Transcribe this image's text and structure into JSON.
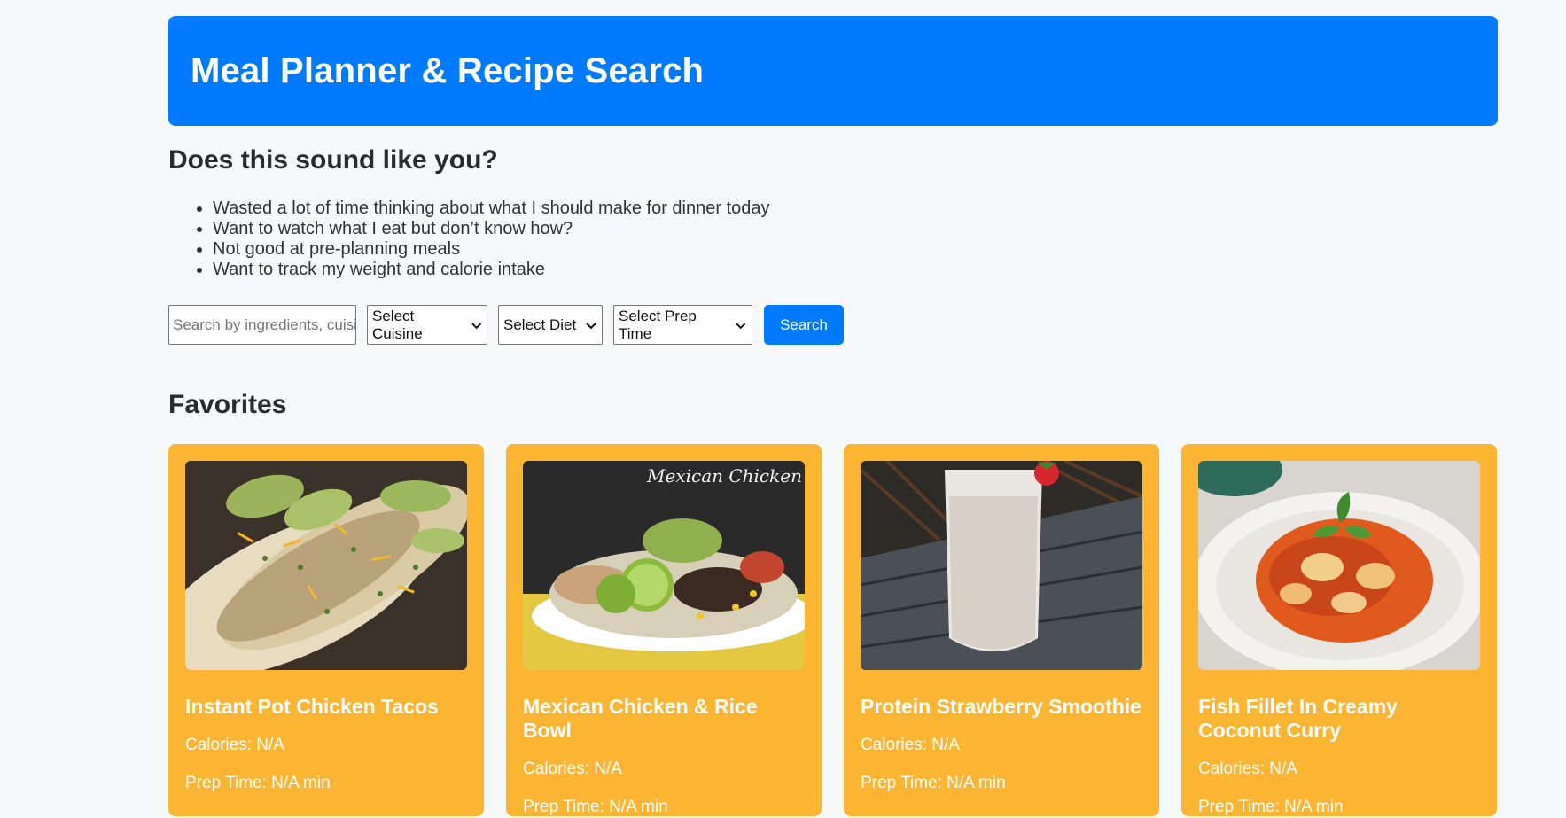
{
  "header": {
    "title": "Meal Planner & Recipe Search"
  },
  "intro": {
    "heading": "Does this sound like you?",
    "items": [
      "Wasted a lot of time thinking about what I should make for dinner today",
      "Want to watch what I eat but don’t know how?",
      "Not good at pre-planning meals",
      "Want to track my weight and calorie intake"
    ]
  },
  "search": {
    "placeholder": "Search by ingredients, cuisine, or dish",
    "cuisine": "Select Cuisine",
    "diet": "Select Diet",
    "prep_time": "Select Prep Time",
    "button": "Search"
  },
  "favorites": {
    "heading": "Favorites",
    "cards": [
      {
        "title": "Instant Pot Chicken Tacos",
        "calories": "Calories: N/A",
        "prep": "Prep Time: N/A min",
        "image": "chicken-tacos-photo"
      },
      {
        "title": "Mexican Chicken & Rice Bowl",
        "calories": "Calories: N/A",
        "prep": "Prep Time: N/A min",
        "image": "rice-bowl-photo",
        "image_text": "Mexican Chicken & Rice Bowl"
      },
      {
        "title": "Protein Strawberry Smoothie",
        "calories": "Calories: N/A",
        "prep": "Prep Time: N/A min",
        "image": "smoothie-photo"
      },
      {
        "title": "Fish Fillet In Creamy Coconut Curry",
        "calories": "Calories: N/A",
        "prep": "Prep Time: N/A min",
        "image": "curry-photo"
      }
    ]
  },
  "colors": {
    "accent": "#007bff",
    "card": "#fbb533",
    "background": "#f7f8fa"
  }
}
